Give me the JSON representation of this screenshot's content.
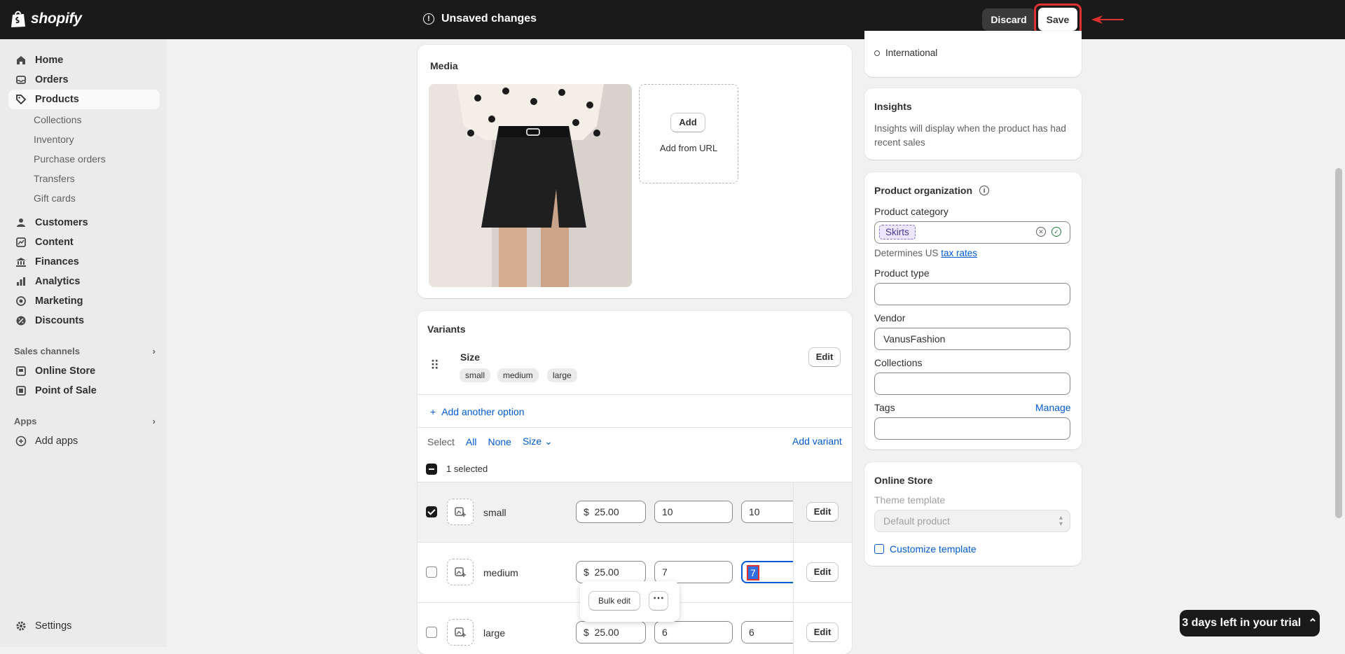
{
  "topbar": {
    "brand": "shopify",
    "status": "Unsaved changes",
    "discard_label": "Discard",
    "save_label": "Save"
  },
  "sidebar": {
    "items": [
      {
        "label": "Home",
        "icon": "home-icon"
      },
      {
        "label": "Orders",
        "icon": "orders-icon"
      },
      {
        "label": "Products",
        "icon": "tag-icon"
      },
      {
        "label": "Customers",
        "icon": "person-icon"
      },
      {
        "label": "Content",
        "icon": "content-icon"
      },
      {
        "label": "Finances",
        "icon": "bank-icon"
      },
      {
        "label": "Analytics",
        "icon": "chart-icon"
      },
      {
        "label": "Marketing",
        "icon": "target-icon"
      },
      {
        "label": "Discounts",
        "icon": "discount-icon"
      }
    ],
    "product_subitems": [
      "Collections",
      "Inventory",
      "Purchase orders",
      "Transfers",
      "Gift cards"
    ],
    "sales_channels_label": "Sales channels",
    "channels": [
      "Online Store",
      "Point of Sale"
    ],
    "apps_label": "Apps",
    "add_apps": "Add apps",
    "settings": "Settings"
  },
  "media": {
    "title": "Media",
    "add_label": "Add",
    "add_url_label": "Add from URL"
  },
  "variants": {
    "title": "Variants",
    "option_name": "Size",
    "option_values": [
      "small",
      "medium",
      "large"
    ],
    "edit_label": "Edit",
    "add_option": "Add another option",
    "select_label": "Select",
    "all_label": "All",
    "none_label": "None",
    "size_filter": "Size",
    "add_variant": "Add variant",
    "selected_count": "1 selected",
    "rows": [
      {
        "name": "small",
        "currency": "$",
        "price": "25.00",
        "qty1": "10",
        "qty2": "10",
        "checked": true
      },
      {
        "name": "medium",
        "currency": "$",
        "price": "25.00",
        "qty1": "7",
        "qty2": "7",
        "checked": false
      },
      {
        "name": "large",
        "currency": "$",
        "price": "25.00",
        "qty1": "6",
        "qty2": "6",
        "checked": false
      }
    ],
    "bulk_edit": "Bulk edit"
  },
  "right": {
    "international": "International",
    "insights_title": "Insights",
    "insights_text": "Insights will display when the product has had recent sales",
    "org_title": "Product organization",
    "category_label": "Product category",
    "category_value": "Skirts",
    "determines_text": "Determines US ",
    "tax_link": "tax rates",
    "type_label": "Product type",
    "type_value": "",
    "vendor_label": "Vendor",
    "vendor_value": "VanusFashion",
    "collections_label": "Collections",
    "collections_value": "",
    "tags_label": "Tags",
    "manage_label": "Manage",
    "tags_value": "",
    "online_store_title": "Online Store",
    "theme_label": "Theme template",
    "theme_value": "Default product",
    "customize": "Customize template"
  },
  "trial": {
    "label": "3 days left in your trial"
  }
}
